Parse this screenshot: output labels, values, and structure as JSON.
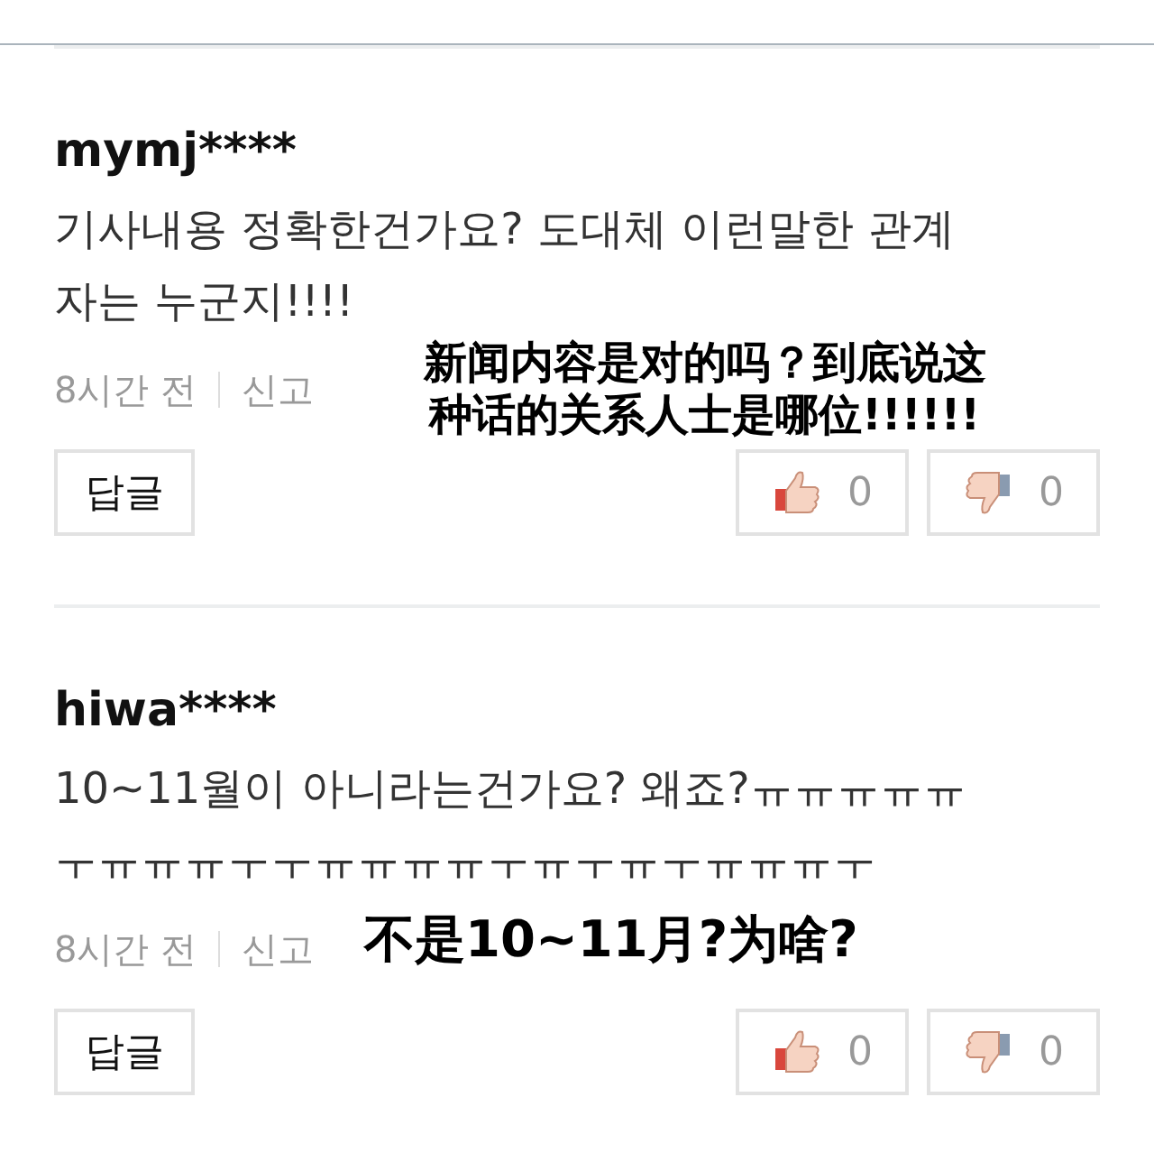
{
  "comments": [
    {
      "author": "mymj****",
      "text": "기사내용 정확한건가요? 도대체 이런말한 관계자는 누군지!!!!",
      "translation": "新闻内容是对的吗？到底说这种话的关系人士是哪位!!!!!!",
      "time": "8시간 전",
      "report": "신고",
      "reply_button": "답글",
      "likes": "0",
      "dislikes": "0"
    },
    {
      "author": "hiwa****",
      "text": "10~11월이 아니라는건가요? 왜죠?ㅠㅠㅠㅠㅠㅜㅠㅠㅠㅜㅜㅠㅠㅠㅠㅜㅠㅜㅠㅜㅠㅠㅠㅜ",
      "translation": "不是10~11月?为啥?",
      "time": "8시간 전",
      "report": "신고",
      "reply_button": "답글",
      "likes": "0",
      "dislikes": "0"
    }
  ]
}
